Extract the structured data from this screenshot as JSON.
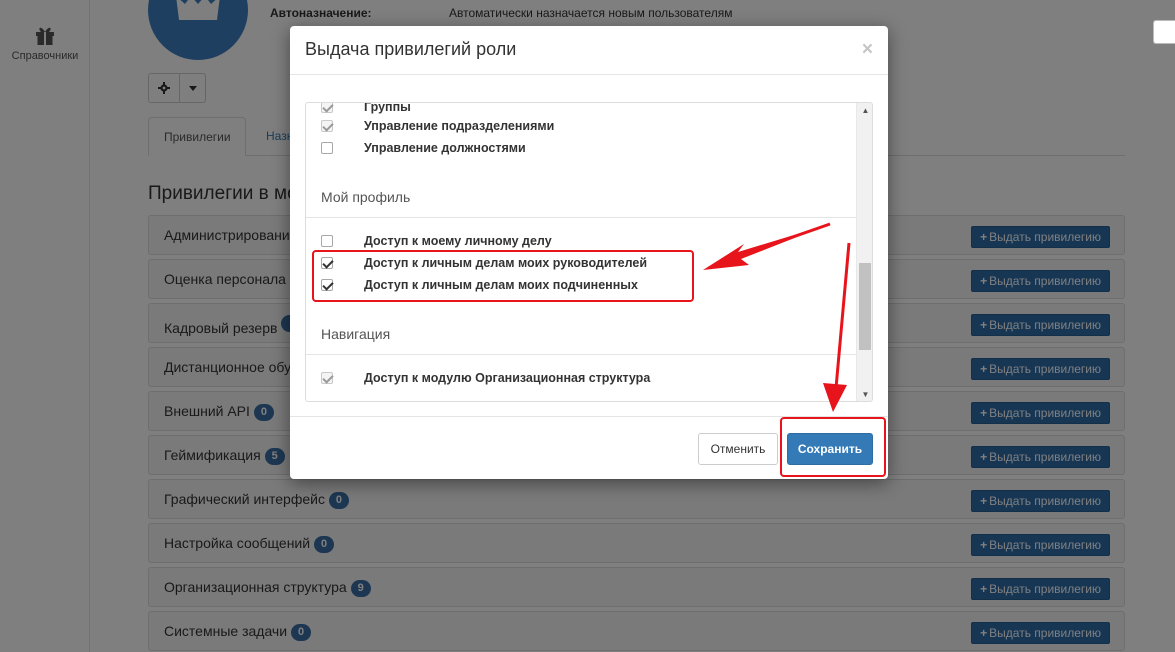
{
  "sidebar": {
    "reference_label": "Справочники",
    "reference_icon": "gift-icon"
  },
  "profile": {
    "auto_assign_label": "Автоназначение:",
    "auto_assign_value": "Автоматически назначается новым пользователям"
  },
  "tabs": [
    {
      "label": "Привилегии"
    },
    {
      "label": "Назн"
    }
  ],
  "section_title": "Привилегии в мо",
  "give_label": "Выдать привилегию",
  "privilege_rows": [
    {
      "name": "Администрировани",
      "badge": ""
    },
    {
      "name": "Оценка персонала",
      "badge": ""
    },
    {
      "name": "Кадровый резерв",
      "badge": " "
    },
    {
      "name": "Дистанционное обу",
      "badge": ""
    },
    {
      "name": "Внешний API",
      "badge": "0"
    },
    {
      "name": "Геймификация",
      "badge": "5"
    },
    {
      "name": "Графический интерфейс",
      "badge": "0"
    },
    {
      "name": "Настройка сообщений",
      "badge": "0"
    },
    {
      "name": "Организационная структура",
      "badge": "9"
    },
    {
      "name": "Системные задачи",
      "badge": "0"
    }
  ],
  "modal": {
    "title": "Выдача привилегий роли",
    "close_symbol": "×",
    "groups": [
      {
        "items": [
          {
            "label": "Группы",
            "checked": true,
            "disabled": true
          },
          {
            "label": "Управление подразделениями",
            "checked": true,
            "disabled": true
          },
          {
            "label": "Управление должностями",
            "checked": false,
            "disabled": false
          }
        ]
      },
      {
        "title": "Мой профиль",
        "items": [
          {
            "label": "Доступ к моему личному делу",
            "checked": false,
            "disabled": false
          },
          {
            "label": "Доступ к личным делам моих руководителей",
            "checked": true,
            "disabled": false
          },
          {
            "label": "Доступ к личным делам моих подчиненных",
            "checked": true,
            "disabled": false
          }
        ]
      },
      {
        "title": "Навигация",
        "items": [
          {
            "label": "Доступ к модулю Организационная структура",
            "checked": true,
            "disabled": true
          }
        ]
      }
    ],
    "cancel_label": "Отменить",
    "save_label": "Сохранить"
  },
  "colors": {
    "primary": "#337ab7",
    "badge": "#3a6ea5",
    "annotation": "#e8141c"
  }
}
